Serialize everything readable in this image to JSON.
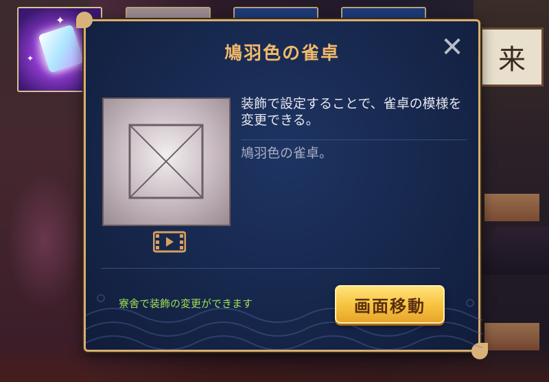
{
  "background": {
    "sign_char": "来"
  },
  "dialog": {
    "title": "鳩羽色の雀卓",
    "close_symbol": "✕",
    "description": "装飾で設定することで、雀卓の模様を変更できる。",
    "sub_description": "鳩羽色の雀卓。",
    "note": "寮舎で装飾の変更ができます",
    "move_button_label": "画面移動"
  },
  "colors": {
    "title": "#f2ba6a",
    "border": "#d8b070",
    "note": "#9fe05a",
    "button": "#f6c23e",
    "panel": "#16264a"
  }
}
